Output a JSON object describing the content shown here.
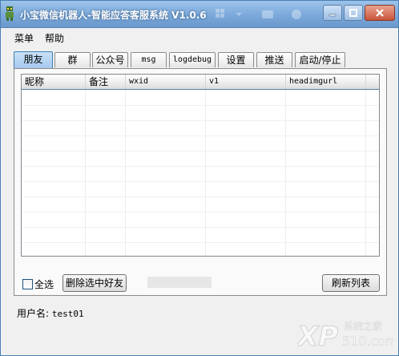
{
  "window": {
    "title": "小宝微信机器人-智能应答客服系统 V1.0.6"
  },
  "menu": {
    "items": [
      "菜单",
      "帮助"
    ]
  },
  "tabs": [
    "朋友",
    "群",
    "公众号",
    "msg",
    "logdebug",
    "设置",
    "推送",
    "启动/停止"
  ],
  "active_tab": "朋友",
  "table": {
    "columns": [
      "昵称",
      "备注",
      "wxid",
      "v1",
      "headimgurl"
    ],
    "rows": []
  },
  "controls": {
    "select_all_label": "全选",
    "select_all_checked": false,
    "delete_button": "删除选中好友",
    "refresh_button": "刷新列表"
  },
  "status": {
    "username_label": "用户名:",
    "username_value": "test01"
  },
  "watermark": {
    "text": "系统之家",
    "domain": "510.com"
  },
  "colors": {
    "titlebar": "#7ba9da",
    "active_tab": "#a6c9ee",
    "watermark": "#ffffff"
  }
}
